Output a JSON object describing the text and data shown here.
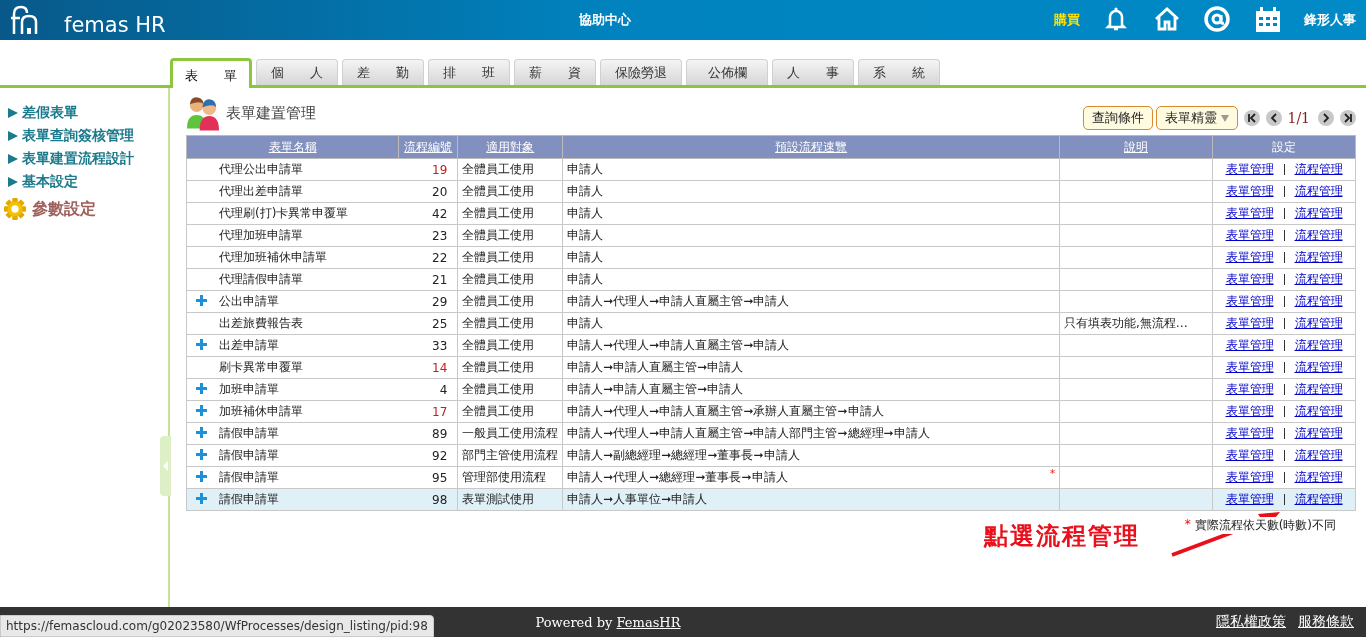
{
  "header": {
    "logo": "femas HR",
    "title": "協助中心",
    "buy": "購買",
    "company": "鋒形人事"
  },
  "tabs": [
    {
      "label": "表 單",
      "selected": true
    },
    {
      "label": "個 人",
      "selected": false
    },
    {
      "label": "差 勤",
      "selected": false
    },
    {
      "label": "排 班",
      "selected": false
    },
    {
      "label": "薪 資",
      "selected": false
    },
    {
      "label": "保險勞退",
      "selected": false
    },
    {
      "label": "公佈欄",
      "selected": false
    },
    {
      "label": "人 事",
      "selected": false
    },
    {
      "label": "系 統",
      "selected": false
    }
  ],
  "sidebar": {
    "items": [
      "差假表單",
      "表單查詢簽核管理",
      "表單建置流程設計",
      "基本設定"
    ],
    "settings": "參數設定"
  },
  "page": {
    "title": "表單建置管理",
    "query_button": "查詢條件",
    "wizard_button": "表單精靈",
    "pager": "1/1"
  },
  "table": {
    "columns": [
      {
        "label": "表單名稱",
        "link": true
      },
      {
        "label": "流程編號",
        "link": true
      },
      {
        "label": "適用對象",
        "link": true
      },
      {
        "label": "預設流程速覽",
        "link": true
      },
      {
        "label": "說明",
        "link": true
      },
      {
        "label": "設定",
        "link": false
      }
    ],
    "rows": [
      {
        "name": "代理公出申請單",
        "id": "19",
        "id_red": true,
        "target": "全體員工使用",
        "flow": "申請人",
        "note": "",
        "expandable": false,
        "flagged": false,
        "selected": false,
        "actions": [
          "表單管理",
          "流程管理"
        ]
      },
      {
        "name": "代理出差申請單",
        "id": "20",
        "id_red": false,
        "target": "全體員工使用",
        "flow": "申請人",
        "note": "",
        "expandable": false,
        "flagged": false,
        "selected": false,
        "actions": [
          "表單管理",
          "流程管理"
        ]
      },
      {
        "name": "代理刷(打)卡異常申覆單",
        "id": "42",
        "id_red": false,
        "target": "全體員工使用",
        "flow": "申請人",
        "note": "",
        "expandable": false,
        "flagged": false,
        "selected": false,
        "actions": [
          "表單管理",
          "流程管理"
        ]
      },
      {
        "name": "代理加班申請單",
        "id": "23",
        "id_red": false,
        "target": "全體員工使用",
        "flow": "申請人",
        "note": "",
        "expandable": false,
        "flagged": false,
        "selected": false,
        "actions": [
          "表單管理",
          "流程管理"
        ]
      },
      {
        "name": "代理加班補休申請單",
        "id": "22",
        "id_red": false,
        "target": "全體員工使用",
        "flow": "申請人",
        "note": "",
        "expandable": false,
        "flagged": false,
        "selected": false,
        "actions": [
          "表單管理",
          "流程管理"
        ]
      },
      {
        "name": "代理請假申請單",
        "id": "21",
        "id_red": false,
        "target": "全體員工使用",
        "flow": "申請人",
        "note": "",
        "expandable": false,
        "flagged": false,
        "selected": false,
        "actions": [
          "表單管理",
          "流程管理"
        ]
      },
      {
        "name": "公出申請單",
        "id": "29",
        "id_red": false,
        "target": "全體員工使用",
        "flow": "申請人➞代理人➞申請人直屬主管➞申請人",
        "note": "",
        "expandable": true,
        "flagged": false,
        "selected": false,
        "actions": [
          "表單管理",
          "流程管理"
        ]
      },
      {
        "name": "出差旅費報告表",
        "id": "25",
        "id_red": false,
        "target": "全體員工使用",
        "flow": "申請人",
        "note": "只有填表功能,無流程…",
        "expandable": false,
        "flagged": false,
        "selected": false,
        "actions": [
          "表單管理",
          "流程管理"
        ]
      },
      {
        "name": "出差申請單",
        "id": "33",
        "id_red": false,
        "target": "全體員工使用",
        "flow": "申請人➞代理人➞申請人直屬主管➞申請人",
        "note": "",
        "expandable": true,
        "flagged": false,
        "selected": false,
        "actions": [
          "表單管理",
          "流程管理"
        ]
      },
      {
        "name": "刷卡異常申覆單",
        "id": "14",
        "id_red": true,
        "target": "全體員工使用",
        "flow": "申請人➞申請人直屬主管➞申請人",
        "note": "",
        "expandable": false,
        "flagged": false,
        "selected": false,
        "actions": [
          "表單管理",
          "流程管理"
        ]
      },
      {
        "name": "加班申請單",
        "id": "4",
        "id_red": false,
        "target": "全體員工使用",
        "flow": "申請人➞申請人直屬主管➞申請人",
        "note": "",
        "expandable": true,
        "flagged": false,
        "selected": false,
        "actions": [
          "表單管理",
          "流程管理"
        ]
      },
      {
        "name": "加班補休申請單",
        "id": "17",
        "id_red": true,
        "target": "全體員工使用",
        "flow": "申請人➞代理人➞申請人直屬主管➞承辦人直屬主管➞申請人",
        "note": "",
        "expandable": true,
        "flagged": false,
        "selected": false,
        "actions": [
          "表單管理",
          "流程管理"
        ]
      },
      {
        "name": "請假申請單",
        "id": "89",
        "id_red": false,
        "target": "一般員工使用流程",
        "flow": "申請人➞代理人➞申請人直屬主管➞申請人部門主管➞總經理➞申請人",
        "note": "",
        "expandable": true,
        "flagged": false,
        "selected": false,
        "actions": [
          "表單管理",
          "流程管理"
        ]
      },
      {
        "name": "請假申請單",
        "id": "92",
        "id_red": false,
        "target": "部門主管使用流程",
        "flow": "申請人➞副總經理➞總經理➞董事長➞申請人",
        "note": "",
        "expandable": true,
        "flagged": false,
        "selected": false,
        "actions": [
          "表單管理",
          "流程管理"
        ]
      },
      {
        "name": "請假申請單",
        "id": "95",
        "id_red": false,
        "target": "管理部使用流程",
        "flow": "申請人➞代理人➞總經理➞董事長➞申請人",
        "note": "",
        "expandable": true,
        "flagged": true,
        "selected": false,
        "actions": [
          "表單管理",
          "流程管理"
        ]
      },
      {
        "name": "請假申請單",
        "id": "98",
        "id_red": false,
        "target": "表單測試使用",
        "flow": "申請人➞人事單位➞申請人",
        "note": "",
        "expandable": true,
        "flagged": false,
        "selected": true,
        "actions": [
          "表單管理",
          "流程管理"
        ]
      }
    ],
    "footnote_mark": "*",
    "footnote": "實際流程依天數(時數)不同"
  },
  "annotation": "點選流程管理",
  "footer": {
    "powered": "Powered by ",
    "brand": "FemasHR",
    "links": [
      "隱私權政策",
      "服務條款"
    ],
    "status_url": "https://femascloud.com/g02023580/WfProcesses/design_listing/pid:98"
  }
}
